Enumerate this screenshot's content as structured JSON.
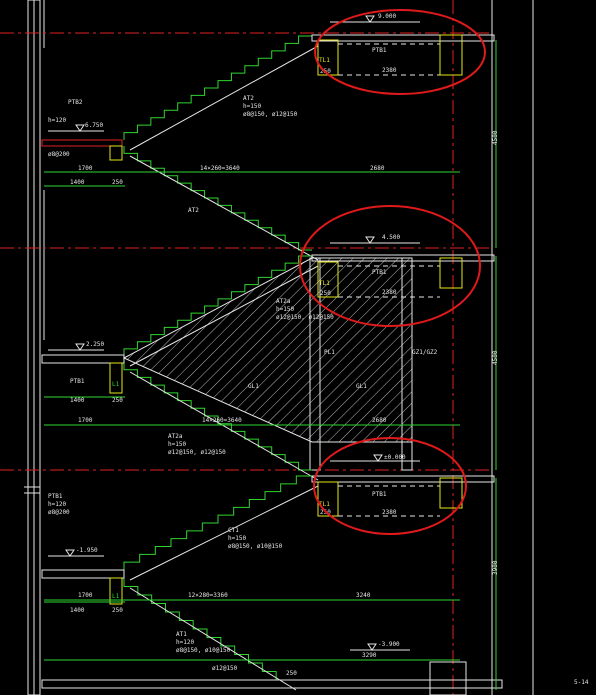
{
  "levels": {
    "top": "9.000",
    "mid": "4.500",
    "lower": "±0.000",
    "land_upper": "6.750",
    "land_mid": "2.250",
    "land_low": "-1.950",
    "bottom": "-3.900"
  },
  "beams": {
    "ptb1": "PTB1",
    "ptb2": "PTB2",
    "l1": "L1",
    "tl1": "TL1",
    "pl1": "PL1",
    "gl1": "GL1",
    "gz": "GZ1/GZ2",
    "col": "250"
  },
  "flights": {
    "at2": "AT2",
    "at2a": "AT2a",
    "at1": "AT1",
    "ct1": "CT1",
    "at2_h": "h=150",
    "at2a_h": "h=150",
    "ct1_h": "h=150",
    "at1_h": "h=120",
    "ptb1_h": "h=120",
    "ptb2_h": "h=120",
    "at2_reinf": "ø8@150, ø12@150",
    "at2a_reinf": "ø12@150, ø12@150",
    "at1_reinf": "ø8@150, ø10@150",
    "ct1_reinf": "ø8@150, ø10@150",
    "ptb_reinf": "ø8@200",
    "bottom_reinf": "ø12@150",
    "tread": "14×260=3640",
    "tread_low": "12×280=3360"
  },
  "dims": {
    "d1700": "1700",
    "d1400": "1400",
    "d250": "250",
    "d2680": "2680",
    "d2380": "2380",
    "d3240": "3240",
    "d3290": "3290",
    "v4500": "4500",
    "v3900": "3900"
  },
  "corner_tag": "5-14"
}
